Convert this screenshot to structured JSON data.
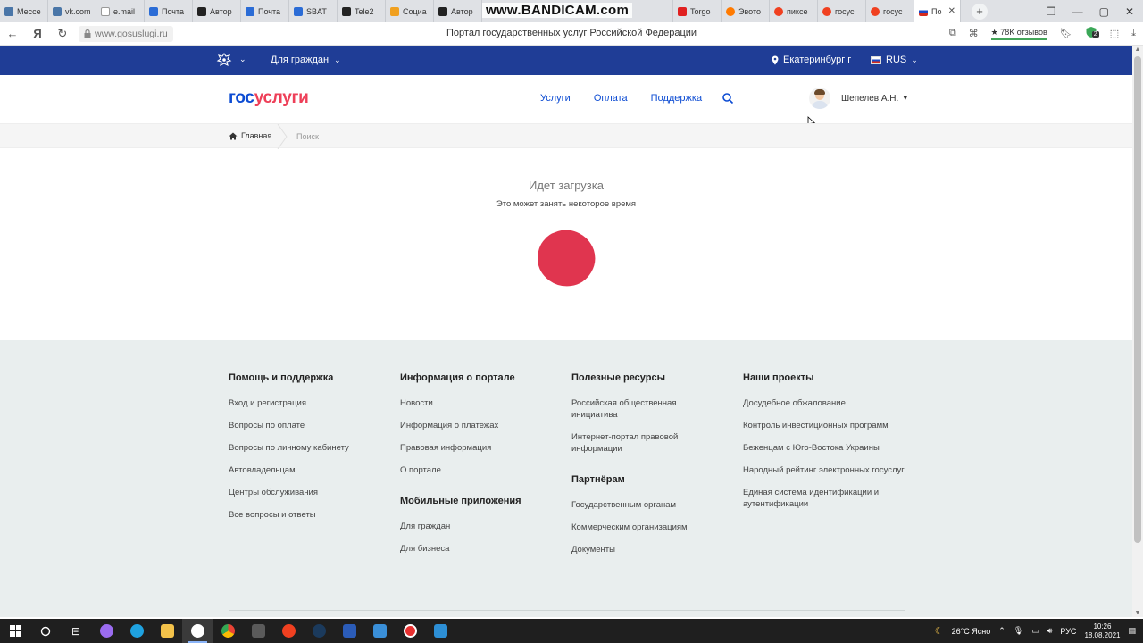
{
  "browser": {
    "tabs": [
      {
        "label": "Мессе",
        "color": "#4a76a8"
      },
      {
        "label": "vk.com",
        "color": "#4a76a8"
      },
      {
        "label": "e.mail",
        "color": "#ffffff"
      },
      {
        "label": "Почта",
        "color": "#2b6cd6"
      },
      {
        "label": "Автор",
        "color": "#222222"
      },
      {
        "label": "Почта",
        "color": "#2b6cd6"
      },
      {
        "label": "SBAT",
        "color": "#2b6cd6"
      },
      {
        "label": "Tele2",
        "color": "#222222"
      },
      {
        "label": "Социа",
        "color": "#f0a020"
      },
      {
        "label": "Автор",
        "color": "#222222"
      },
      {
        "label": "Torgo",
        "color": "#e02020"
      },
      {
        "label": "Эвото",
        "color": "#ff7a00"
      },
      {
        "label": "пиксе",
        "color": "#f04020"
      },
      {
        "label": "госус",
        "color": "#f04020"
      },
      {
        "label": "госус",
        "color": "#f04020"
      }
    ],
    "active_tab": {
      "label": "По",
      "close": "✕"
    },
    "new_tab": "+",
    "watermark": "www.BANDICAM.com",
    "url": "www.gosuslugi.ru",
    "page_heading": "Портал государственных услуг Российской Федерации",
    "reviews": "★ 78K отзывов",
    "extension_badge": "2"
  },
  "gov_bar": {
    "for_citizens": "Для граждан",
    "city": "Екатеринбург г",
    "language": "RUS",
    "color": "#1f3d96"
  },
  "header": {
    "logo_part1": "гос",
    "logo_part2": "услуги",
    "nav": [
      "Услуги",
      "Оплата",
      "Поддержка"
    ],
    "user_name": "Шепелев А.Н."
  },
  "breadcrumb": {
    "home": "Главная",
    "current": "Поиск"
  },
  "loading": {
    "title": "Идет загрузка",
    "subtitle": "Это может занять некоторое время",
    "color": "#e0354f"
  },
  "footer": {
    "help": {
      "title": "Помощь и поддержка",
      "links": [
        "Вход и регистрация",
        "Вопросы по оплате",
        "Вопросы по личному кабинету",
        "Автовладельцам",
        "Центры обслуживания",
        "Все вопросы и ответы"
      ]
    },
    "info": {
      "title": "Информация о портале",
      "links": [
        "Новости",
        "Информация о платежах",
        "Правовая информация",
        "О портале"
      ]
    },
    "mobile": {
      "title": "Мобильные приложения",
      "links": [
        "Для граждан",
        "Для бизнеса"
      ]
    },
    "resources": {
      "title": "Полезные ресурсы",
      "links": [
        "Российская общественная инициатива",
        "Интернет-портал правовой информации"
      ]
    },
    "partners": {
      "title": "Партнёрам",
      "links": [
        "Государственным органам",
        "Коммерческим организациям",
        "Документы"
      ]
    },
    "projects": {
      "title": "Наши проекты",
      "links": [
        "Досудебное обжалование",
        "Контроль инвестиционных программ",
        "Беженцам с Юго-Востока Украины",
        "Народный рейтинг электронных госуслуг",
        "Единая система идентификации и аутентификации"
      ]
    }
  },
  "taskbar": {
    "weather": "26°C Ясно",
    "language": "РУС",
    "time": "10:26",
    "date": "18.08.2021"
  }
}
